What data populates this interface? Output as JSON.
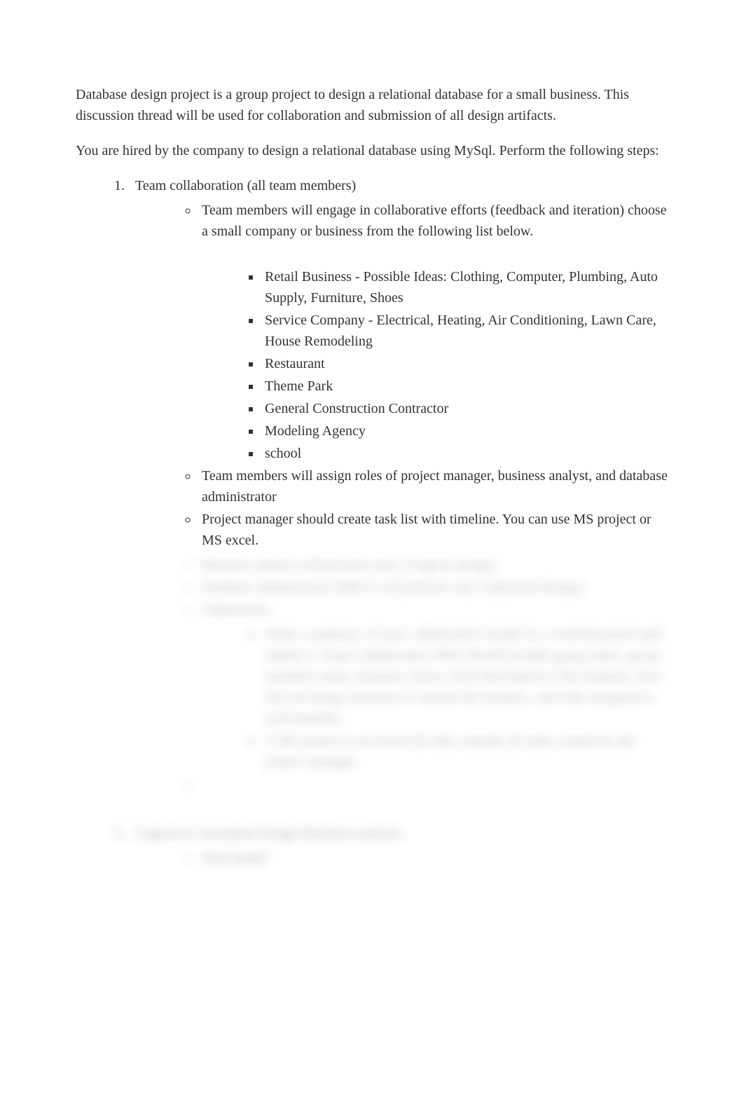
{
  "intro": {
    "p1": "Database design project is a group project to design a relational database for a small business. This discussion thread will be used for collaboration and submission of all design artifacts.",
    "p2": "You are hired by the company to design a relational database using MySql. Perform the following steps:"
  },
  "step1": {
    "title": "Team collaboration       (all team members)",
    "bullets": {
      "b1": "Team members will engage in collaborative efforts (feedback and iteration) choose     a small company or business from the following list below.",
      "businesses": {
        "i1": "Retail Business - Possible Ideas: Clothing, Computer, Plumbing, Auto Supply, Furniture, Shoes",
        "i2": "Service Company - Electrical, Heating, Air Conditioning, Lawn Care, House Remodeling",
        "i3": "Restaurant",
        "i4": "Theme Park",
        "i5": "General Construction Contractor",
        "i6": "Modeling Agency",
        "i7": "school"
      },
      "b2": "Team members will assign roles of       project manager, business analyst, and database administrator",
      "b3": "Project manager should create task list with timeline. You can use MS project or MS excel.",
      "blurred": {
        "b4": "Business analyst will perform step 2 (logical design)",
        "b5": "Database administrator (DBA) will perform step 3 (physical design)",
        "b6": "Submission:",
        "sub_items": {
          "s1": "Write a summary of your collaborative results in a word document and submit it. Team collaboration effort should include group name, group members name, business choice, brief description of the business, how did you bring consensus to choose the business, and roles assigned to each member.",
          "s2": "A MS project or an Excel file that contains all tasks created by the project manager."
        }
      }
    }
  },
  "step2": {
    "title": "Logical or conceptual design (business analyst)",
    "bullets": {
      "b1": "Data model"
    }
  }
}
